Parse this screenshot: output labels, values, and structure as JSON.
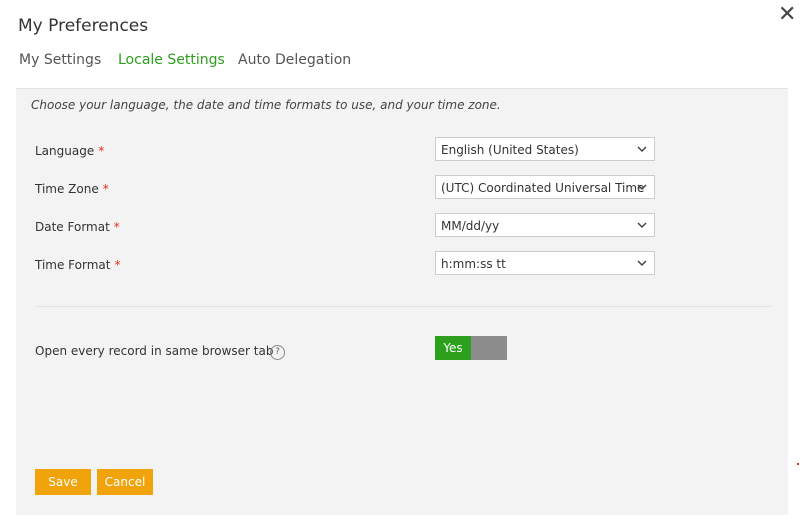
{
  "dialog": {
    "title": "My Preferences",
    "close_icon": "close-icon"
  },
  "tabs": [
    {
      "label": "My Settings",
      "active": false
    },
    {
      "label": "Locale Settings",
      "active": true
    },
    {
      "label": "Auto Delegation",
      "active": false
    }
  ],
  "locale": {
    "description": "Choose your language, the date and time formats to use, and your time zone.",
    "required_marker": "*",
    "fields": [
      {
        "label": "Language",
        "value": "English (United States)"
      },
      {
        "label": "Time Zone",
        "value": "(UTC) Coordinated Universal Time"
      },
      {
        "label": "Date Format",
        "value": "MM/dd/yy"
      },
      {
        "label": "Time Format",
        "value": "h:mm:ss tt"
      }
    ],
    "same_tab": {
      "label": "Open every record in same browser tab",
      "help_text": "?",
      "toggle_value": "Yes",
      "enabled": true
    }
  },
  "buttons": {
    "save": "Save",
    "cancel": "Cancel"
  },
  "colors": {
    "accent_green": "#2ca01c",
    "button_orange": "#f0a30a",
    "required_red": "#e0301e",
    "panel_bg": "#f3f3f3"
  }
}
